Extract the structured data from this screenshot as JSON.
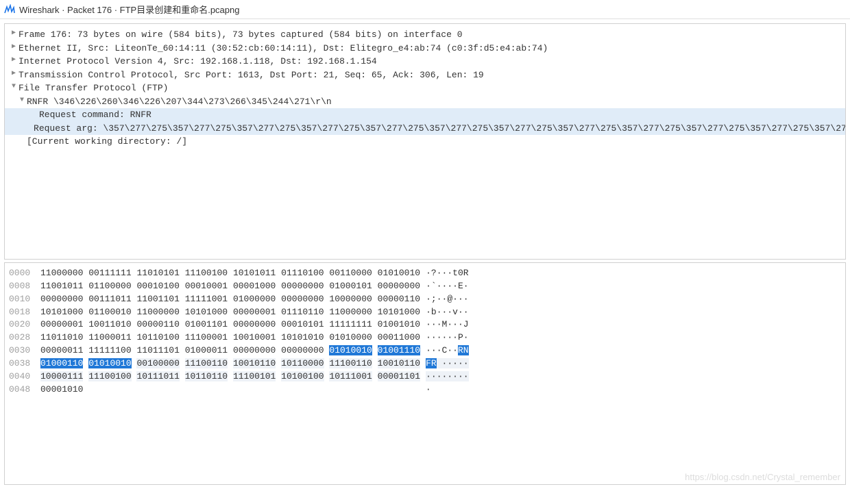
{
  "title": "Wireshark · Packet 176 · FTP目录创建和重命名.pcapng",
  "tree": {
    "frame": "Frame 176: 73 bytes on wire (584 bits), 73 bytes captured (584 bits) on interface 0",
    "ethernet": "Ethernet II, Src: LiteonTe_60:14:11 (30:52:cb:60:14:11), Dst: Elitegro_e4:ab:74 (c0:3f:d5:e4:ab:74)",
    "ip": "Internet Protocol Version 4, Src: 192.168.1.118, Dst: 192.168.1.154",
    "tcp": "Transmission Control Protocol, Src Port: 1613, Dst Port: 21, Seq: 65, Ack: 306, Len: 19",
    "ftp": "File Transfer Protocol (FTP)",
    "rnfr": "RNFR \\346\\226\\260\\346\\226\\207\\344\\273\\266\\345\\244\\271\\r\\n",
    "req_cmd": "Request command: RNFR",
    "req_arg": "Request arg: \\357\\277\\275\\357\\277\\275\\357\\277\\275\\357\\277\\275\\357\\277\\275\\357\\277\\275\\357\\277\\275\\357\\277\\275\\357\\277\\275\\357\\277\\275\\357\\277\\275\\357\\277\\275\\",
    "cwd": "[Current working directory: /]"
  },
  "hex": [
    {
      "offset": "0000",
      "bytes": "11000000 00111111 11010101 11100100 10101011 01110100 00110000 01010010",
      "ascii": "·?···t0R",
      "sel": [],
      "ascii_sel": []
    },
    {
      "offset": "0008",
      "bytes": "11001011 01100000 00010100 00010001 00001000 00000000 01000101 00000000",
      "ascii": "·`····E·",
      "sel": [],
      "ascii_sel": []
    },
    {
      "offset": "0010",
      "bytes": "00000000 00111011 11001101 11111001 01000000 00000000 10000000 00000110",
      "ascii": "·;··@···",
      "sel": [],
      "ascii_sel": []
    },
    {
      "offset": "0018",
      "bytes": "10101000 01100010 11000000 10101000 00000001 01110110 11000000 10101000",
      "ascii": "·b···v··",
      "sel": [],
      "ascii_sel": []
    },
    {
      "offset": "0020",
      "bytes": "00000001 10011010 00000110 01001101 00000000 00010101 11111111 01001010",
      "ascii": "···M···J",
      "sel": [],
      "ascii_sel": []
    },
    {
      "offset": "0028",
      "bytes": "11011010 11000011 10110100 11100001 10010001 10101010 01010000 00011000",
      "ascii": "······P·",
      "sel": [],
      "ascii_sel": []
    },
    {
      "offset": "0030",
      "bytes": "00000011 11111100 11011101 01000011 00000000 00000000 01010010 01001110",
      "ascii": "···C··RN",
      "sel": [
        6,
        7
      ],
      "ascii_sel": [
        6,
        7
      ]
    },
    {
      "offset": "0038",
      "bytes": "01000110 01010010 00100000 11100110 10010110 10110000 11100110 10010110",
      "ascii": "FR ·····",
      "sel": [
        0,
        1
      ],
      "range": [
        2,
        3,
        4,
        5,
        6,
        7
      ],
      "ascii_sel": [
        0,
        1
      ],
      "ascii_range": [
        2,
        3,
        4,
        5,
        6,
        7
      ]
    },
    {
      "offset": "0040",
      "bytes": "10000111 11100100 10111011 10110110 11100101 10100100 10111001 00001101",
      "ascii": "········",
      "sel": [],
      "range": [
        0,
        1,
        2,
        3,
        4,
        5,
        6,
        7
      ],
      "ascii_range": [
        0,
        1,
        2,
        3,
        4,
        5,
        6,
        7
      ]
    },
    {
      "offset": "0048",
      "bytes": "00001010",
      "ascii": "·",
      "sel": [],
      "ascii_sel": []
    }
  ],
  "watermark": "https://blog.csdn.net/Crystal_remember"
}
